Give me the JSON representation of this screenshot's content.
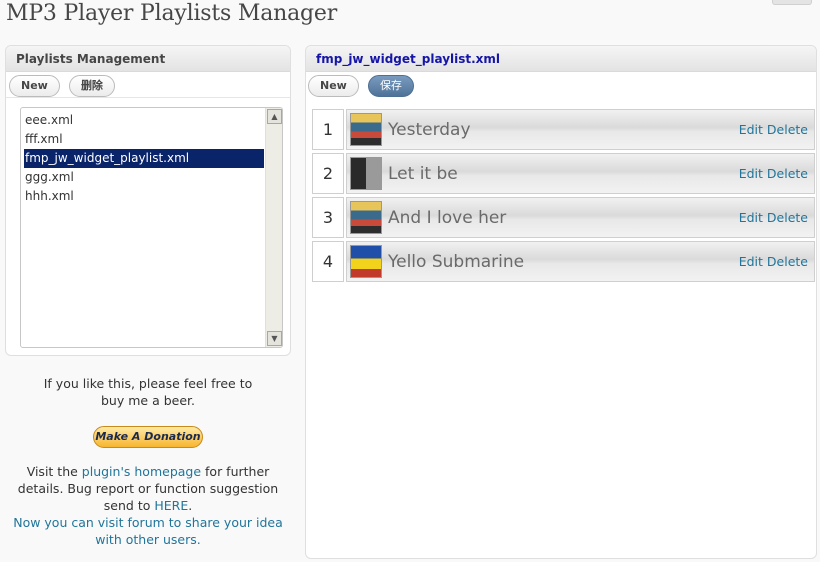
{
  "page_title": "MP3 Player Playlists Manager",
  "left_panel": {
    "title": "Playlists Management",
    "new_label": "New",
    "delete_label": "删除",
    "playlists": [
      "eee.xml",
      "fff.xml",
      "fmp_jw_widget_playlist.xml",
      "ggg.xml",
      "hhh.xml"
    ],
    "selected": "fmp_jw_widget_playlist.xml"
  },
  "info": {
    "beer_line1": "If you like this, please feel free to",
    "beer_line2": "buy me a beer.",
    "donate_label": "Make A Donation",
    "visit_pre": "Visit the ",
    "visit_link": "plugin's homepage",
    "visit_post": " for further",
    "details_line": "details. Bug report or function suggestion",
    "send_pre": "send to ",
    "send_link": "HERE",
    "send_post": ".",
    "forum_line1": "Now you can visit forum to share your idea",
    "forum_line2": "with other users."
  },
  "right_panel": {
    "title": "fmp_jw_widget_playlist.xml",
    "new_label": "New",
    "save_label": "保存",
    "edit_label": "Edit",
    "delete_label": "Delete",
    "tracks": [
      {
        "num": "1",
        "title": "Yesterday",
        "cover": "beatles-yesterday-cover"
      },
      {
        "num": "2",
        "title": "Let it be",
        "cover": "beatles-let-it-be-cover"
      },
      {
        "num": "3",
        "title": "And I love her",
        "cover": "beatles-and-i-love-her-cover"
      },
      {
        "num": "4",
        "title": "Yello Submarine",
        "cover": "yellow-submarine-cover"
      }
    ]
  },
  "colors": {
    "link": "#21759b",
    "selection": "#0a246a",
    "header_title": "#1515a8"
  }
}
